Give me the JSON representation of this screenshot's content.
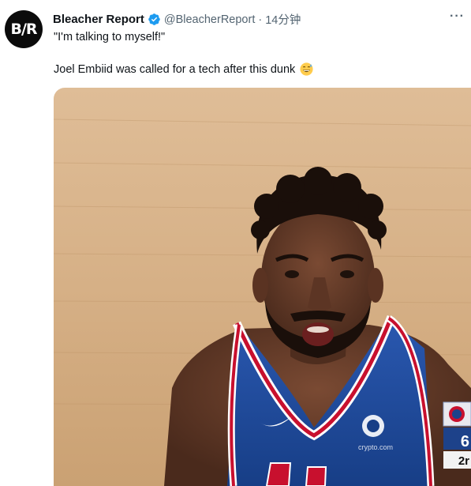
{
  "tweet": {
    "avatar_text": "B/R",
    "author_name": "Bleacher Report",
    "handle": "@BleacherReport",
    "separator": "·",
    "timestamp": "14分钟",
    "quote_line": "\"I'm talking to myself!\"",
    "body_text": "Joel Embiid was called for a tech after this dunk",
    "more_label": "···"
  },
  "media": {
    "type": "video-frame",
    "scorebug": {
      "digit": "6",
      "period_text": "2r"
    },
    "jersey_sponsor": "crypto.com"
  },
  "colors": {
    "verified": "#1d9bf0",
    "jersey_blue": "#1d428a",
    "jersey_red": "#c8102e",
    "court": "#d8b48a",
    "text_secondary": "#536471"
  }
}
